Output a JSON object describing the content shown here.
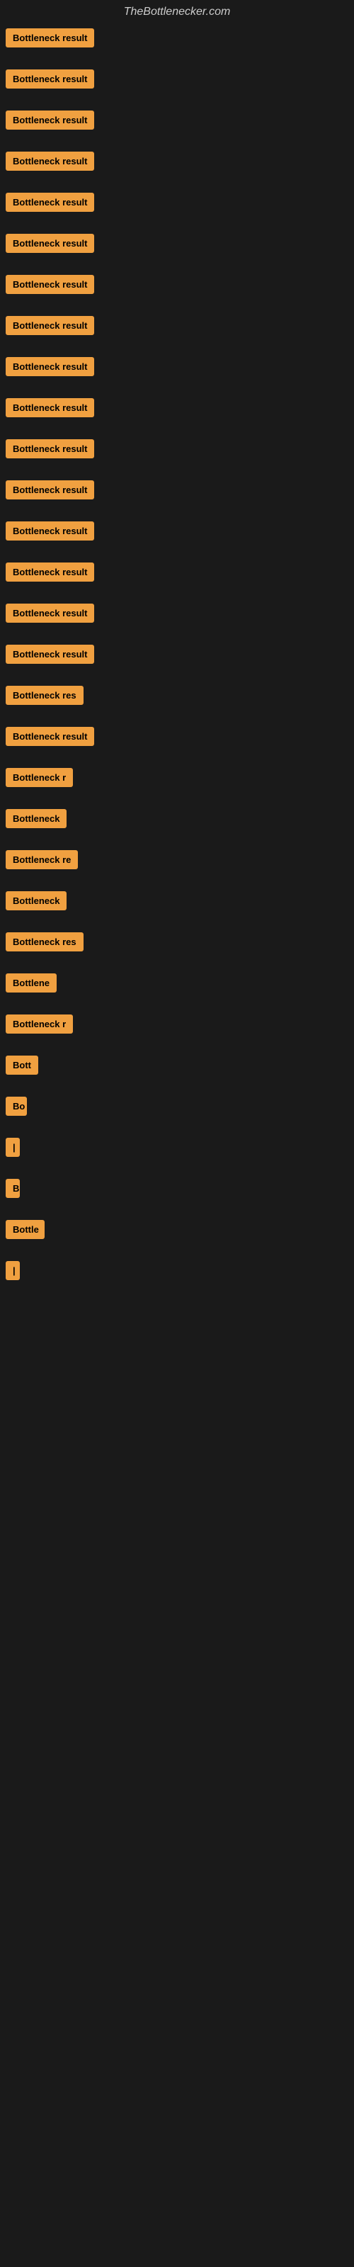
{
  "site": {
    "title": "TheBottlenecker.com"
  },
  "items": [
    {
      "label": "Bottleneck result",
      "width": 140
    },
    {
      "label": "Bottleneck result",
      "width": 140
    },
    {
      "label": "Bottleneck result",
      "width": 140
    },
    {
      "label": "Bottleneck result",
      "width": 140
    },
    {
      "label": "Bottleneck result",
      "width": 140
    },
    {
      "label": "Bottleneck result",
      "width": 140
    },
    {
      "label": "Bottleneck result",
      "width": 140
    },
    {
      "label": "Bottleneck result",
      "width": 140
    },
    {
      "label": "Bottleneck result",
      "width": 140
    },
    {
      "label": "Bottleneck result",
      "width": 140
    },
    {
      "label": "Bottleneck result",
      "width": 140
    },
    {
      "label": "Bottleneck result",
      "width": 140
    },
    {
      "label": "Bottleneck result",
      "width": 140
    },
    {
      "label": "Bottleneck result",
      "width": 140
    },
    {
      "label": "Bottleneck result",
      "width": 140
    },
    {
      "label": "Bottleneck result",
      "width": 140
    },
    {
      "label": "Bottleneck res",
      "width": 120
    },
    {
      "label": "Bottleneck result",
      "width": 130
    },
    {
      "label": "Bottleneck r",
      "width": 105
    },
    {
      "label": "Bottleneck",
      "width": 90
    },
    {
      "label": "Bottleneck re",
      "width": 108
    },
    {
      "label": "Bottleneck",
      "width": 88
    },
    {
      "label": "Bottleneck res",
      "width": 115
    },
    {
      "label": "Bottlene",
      "width": 80
    },
    {
      "label": "Bottleneck r",
      "width": 100
    },
    {
      "label": "Bott",
      "width": 48
    },
    {
      "label": "Bo",
      "width": 30
    },
    {
      "label": "|",
      "width": 10
    },
    {
      "label": "B",
      "width": 20
    },
    {
      "label": "Bottle",
      "width": 55
    },
    {
      "label": "|",
      "width": 8
    }
  ]
}
